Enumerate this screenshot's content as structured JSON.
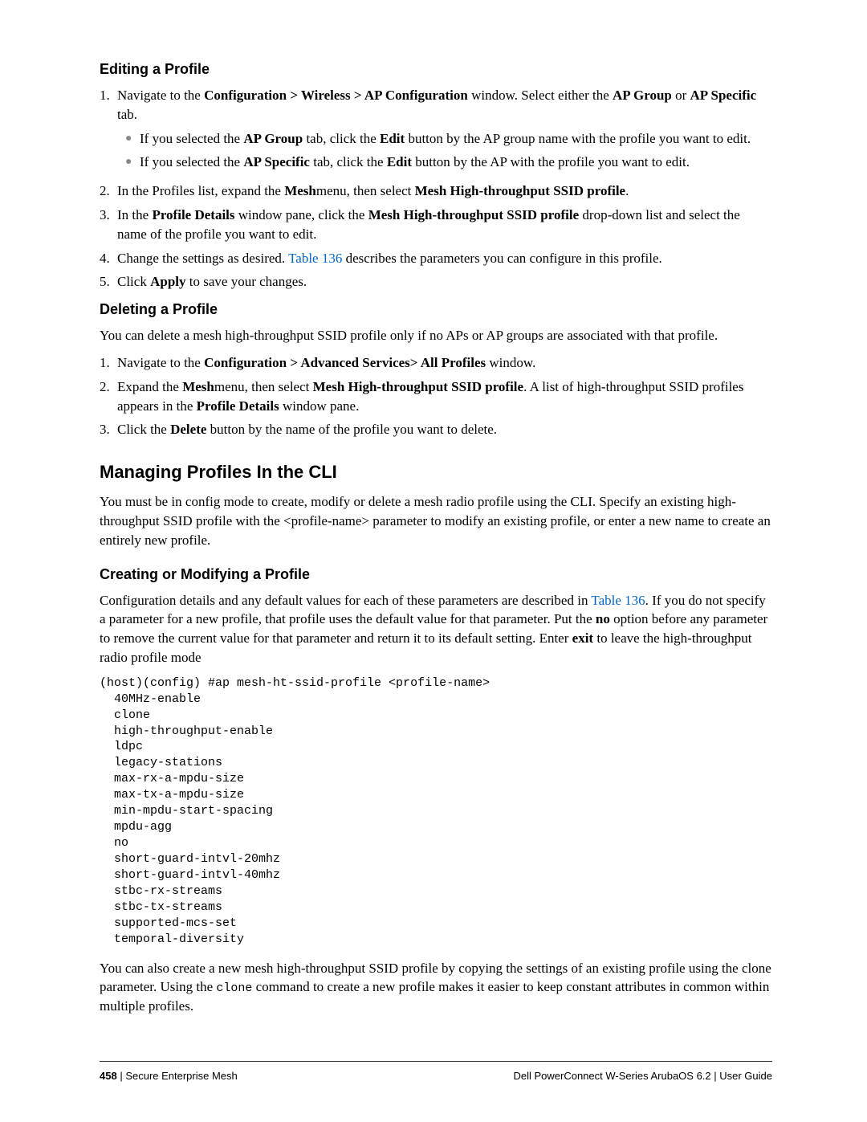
{
  "sections": {
    "editing": {
      "title": "Editing a Profile",
      "step1_pre": "Navigate to the ",
      "step1_b1": "Configuration > Wireless > AP Configuration",
      "step1_mid": " window. Select either the ",
      "step1_b2": "AP Group",
      "step1_or": " or ",
      "step1_b3": "AP Specific",
      "step1_tab": " tab.",
      "sub1_pre": "If you selected the ",
      "sub1_b1": "AP Group",
      "sub1_mid": " tab, click the ",
      "sub1_b2": "Edit",
      "sub1_post": " button by the AP group name with the profile you want to edit.",
      "sub2_pre": "If you selected the ",
      "sub2_b1": "AP Specific",
      "sub2_mid": " tab, click the ",
      "sub2_b2": "Edit",
      "sub2_post": " button by the AP with the profile you want to edit.",
      "step2_pre": "In the Profiles list, expand the ",
      "step2_b1": "Mesh",
      "step2_mid": "menu, then select ",
      "step2_b2": "Mesh High-throughput SSID profile",
      "step2_post": ".",
      "step3_pre": "In the ",
      "step3_b1": "Profile Details",
      "step3_mid": " window pane, click the ",
      "step3_b2": "Mesh High-throughput SSID profile",
      "step3_post": " drop-down list and select the name of the profile you want to edit.",
      "step4_pre": "Change the settings as desired. ",
      "step4_link": "Table 136",
      "step4_post": " describes the parameters you can configure in this profile.",
      "step5_pre": "Click ",
      "step5_b1": "Apply",
      "step5_post": " to save your changes."
    },
    "deleting": {
      "title": "Deleting a Profile",
      "intro": "You can delete a mesh high-throughput SSID profile only if no APs or AP groups are associated with that profile.",
      "step1_pre": "Navigate to the ",
      "step1_b1": "Configuration > Advanced Services> All Profiles",
      "step1_post": " window.",
      "step2_pre": "Expand the ",
      "step2_b1": "Mesh",
      "step2_mid": "menu, then select ",
      "step2_b2": "Mesh High-throughput SSID profile",
      "step2_mid2": ". A list of high-throughput SSID profiles appears in the ",
      "step2_b3": "Profile Details",
      "step2_post": " window pane.",
      "step3_pre": "Click the ",
      "step3_b1": "Delete",
      "step3_post": " button by the name of the profile you want to delete."
    },
    "managing": {
      "title": "Managing Profiles In the CLI",
      "intro": "You must be in config mode to create, modify or delete a mesh radio profile using the CLI. Specify an existing high-throughput SSID profile with the <profile-name> parameter to modify an existing profile, or enter a new name to create an entirely new profile."
    },
    "creating": {
      "title": "Creating or Modifying a Profile",
      "intro_pre": "Configuration details and any default values for each of these parameters are described in ",
      "intro_link": "Table 136",
      "intro_mid": ". If you do not specify a parameter for a new profile, that profile uses the default value for that parameter. Put the ",
      "intro_b1": "no",
      "intro_mid2": " option before any parameter to remove the current value for that parameter and return it to its default setting. Enter ",
      "intro_b2": "exit",
      "intro_post": " to leave the high-throughput radio profile mode",
      "code": "(host)(config) #ap mesh-ht-ssid-profile <profile-name>\n  40MHz-enable\n  clone\n  high-throughput-enable\n  ldpc\n  legacy-stations\n  max-rx-a-mpdu-size\n  max-tx-a-mpdu-size\n  min-mpdu-start-spacing\n  mpdu-agg\n  no\n  short-guard-intvl-20mhz\n  short-guard-intvl-40mhz\n  stbc-rx-streams\n  stbc-tx-streams\n  supported-mcs-set\n  temporal-diversity",
      "outro_pre": "You can also create a new mesh high-throughput SSID profile by copying the settings of an existing profile using the clone parameter. Using the ",
      "outro_code": "clone",
      "outro_post": " command to create a new profile makes it easier to keep constant attributes in common within multiple profiles."
    }
  },
  "footer": {
    "page_number": "458",
    "separator": " | ",
    "chapter": "Secure Enterprise Mesh",
    "right": "Dell PowerConnect W-Series ArubaOS 6.2  |  User Guide"
  }
}
